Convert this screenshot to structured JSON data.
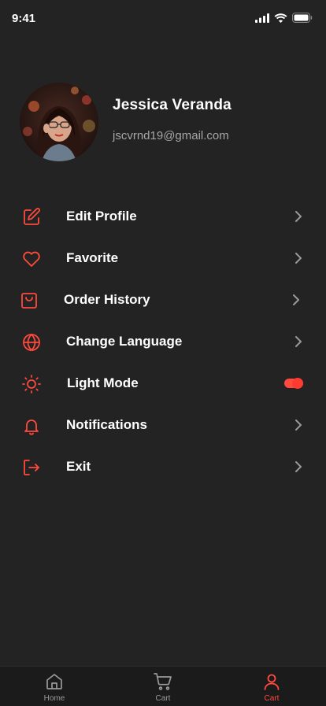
{
  "status_bar": {
    "time": "9:41"
  },
  "profile": {
    "name": "Jessica Veranda",
    "email": "jscvrnd19@gmail.com"
  },
  "menu": {
    "items": [
      {
        "label": "Edit Profile",
        "icon": "edit-icon"
      },
      {
        "label": "Favorite",
        "icon": "heart-icon"
      },
      {
        "label": "Order History",
        "icon": "shopping-bag-icon"
      },
      {
        "label": "Change Language",
        "icon": "globe-icon"
      },
      {
        "label": "Light Mode",
        "icon": "sun-icon",
        "toggle": true
      },
      {
        "label": "Notifications",
        "icon": "bell-icon"
      },
      {
        "label": "Exit",
        "icon": "exit-icon"
      }
    ]
  },
  "tab_bar": {
    "tabs": [
      {
        "label": "Home",
        "icon": "home-icon",
        "active": false
      },
      {
        "label": "Cart",
        "icon": "cart-icon",
        "active": false
      },
      {
        "label": "Cart",
        "icon": "user-icon",
        "active": true
      }
    ]
  },
  "colors": {
    "background": "#232323",
    "accent": "#ff4a3d",
    "secondary_text": "#a6a6a6"
  }
}
